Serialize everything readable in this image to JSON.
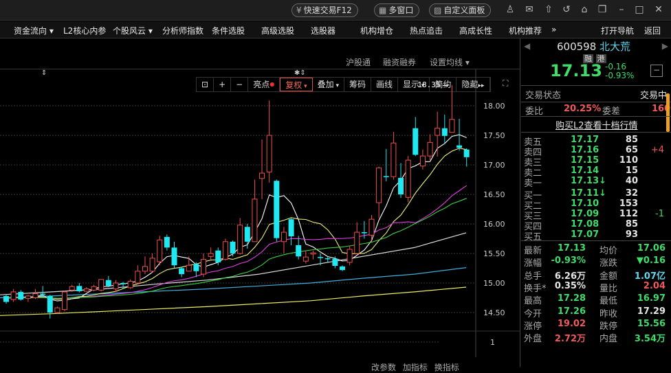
{
  "titlebar": {
    "quick_trade": "快速交易F12",
    "multi_window": "多窗口",
    "custom_panel": "自定义面板"
  },
  "menu": [
    "资金流向",
    "L2核心内参",
    "个股风云",
    "分析师指数",
    "条件选股",
    "高级选股",
    "选股器",
    "机构增仓",
    "热点追击",
    "高成长性",
    "机构推荐",
    "»"
  ],
  "menu_right": [
    "打开导航",
    "返回"
  ],
  "toolbar": [
    "亮点",
    "复权",
    "叠加",
    "筹码",
    "画线",
    "显示",
    "简约",
    "隐藏"
  ],
  "subbar": [
    "沪股通",
    "融资融券",
    "设置均线"
  ],
  "bottom_tabs": [
    "改参数",
    "加指标",
    "换指标"
  ],
  "chart_data": {
    "type": "candlestick",
    "ylim": [
      14.3,
      18.55
    ],
    "yticks": [
      "18.00",
      "17.50",
      "17.00",
      "16.50",
      "16.00",
      "15.50",
      "15.00",
      "14.50"
    ],
    "yvalues": [
      18,
      17.5,
      17,
      16.5,
      16,
      15.5,
      15,
      14.5
    ],
    "high_annotation": "18.35",
    "volume_axis_label": "1",
    "ohlc": [
      [
        14.78,
        14.8,
        14.65,
        14.68
      ],
      [
        14.72,
        14.9,
        14.68,
        14.85
      ],
      [
        14.85,
        14.88,
        14.7,
        14.72
      ],
      [
        14.74,
        14.8,
        14.68,
        14.78
      ],
      [
        14.75,
        14.9,
        14.73,
        14.82
      ],
      [
        14.82,
        14.95,
        14.78,
        14.8
      ],
      [
        14.78,
        14.8,
        14.4,
        14.5
      ],
      [
        14.5,
        14.6,
        14.48,
        14.58
      ],
      [
        14.55,
        14.87,
        14.52,
        14.85
      ],
      [
        14.88,
        14.97,
        14.85,
        14.94
      ],
      [
        14.95,
        15.0,
        14.84,
        14.86
      ],
      [
        14.86,
        14.93,
        14.85,
        14.9
      ],
      [
        14.88,
        14.97,
        14.86,
        14.94
      ],
      [
        14.88,
        15.06,
        14.86,
        15.06
      ],
      [
        15.05,
        15.12,
        14.93,
        14.95
      ],
      [
        14.9,
        15.05,
        14.85,
        15.0
      ],
      [
        15.0,
        15.02,
        14.9,
        14.98
      ],
      [
        14.92,
        15.06,
        14.9,
        15.03
      ],
      [
        15.0,
        15.3,
        14.98,
        15.2
      ],
      [
        15.2,
        15.45,
        15.15,
        15.28
      ],
      [
        15.2,
        15.5,
        15.18,
        15.42
      ],
      [
        15.36,
        15.8,
        15.3,
        15.73
      ],
      [
        15.78,
        15.82,
        15.55,
        15.6
      ],
      [
        15.6,
        15.7,
        15.25,
        15.3
      ],
      [
        15.25,
        15.28,
        15.1,
        15.15
      ],
      [
        15.2,
        15.45,
        15.2,
        15.3
      ],
      [
        15.32,
        15.35,
        15.1,
        15.2
      ],
      [
        15.15,
        15.5,
        15.1,
        15.4
      ],
      [
        15.45,
        15.6,
        15.4,
        15.5
      ],
      [
        15.55,
        15.6,
        15.3,
        15.35
      ],
      [
        15.4,
        15.75,
        15.38,
        15.7
      ],
      [
        15.7,
        15.72,
        15.45,
        15.5
      ],
      [
        15.5,
        16.1,
        15.48,
        15.98
      ],
      [
        15.95,
        16.0,
        15.58,
        15.7
      ],
      [
        15.7,
        16.75,
        15.7,
        16.42
      ],
      [
        16.77,
        17.43,
        16.42,
        16.86
      ],
      [
        16.88,
        18.09,
        16.7,
        17.5
      ],
      [
        16.73,
        16.75,
        15.7,
        15.76
      ],
      [
        15.7,
        15.95,
        15.5,
        15.86
      ],
      [
        16.08,
        16.1,
        15.64,
        15.79
      ],
      [
        15.64,
        15.8,
        15.4,
        15.45
      ],
      [
        15.37,
        15.55,
        15.33,
        15.44
      ],
      [
        15.49,
        15.55,
        15.4,
        15.51
      ],
      [
        15.44,
        15.5,
        15.3,
        15.43
      ],
      [
        15.42,
        15.45,
        15.35,
        15.41
      ],
      [
        15.41,
        15.45,
        15.25,
        15.29
      ],
      [
        15.28,
        15.3,
        15.2,
        15.22
      ],
      [
        15.35,
        15.63,
        15.3,
        15.57
      ],
      [
        15.5,
        16.03,
        15.5,
        15.86
      ],
      [
        15.86,
        16.05,
        15.75,
        15.85
      ],
      [
        15.81,
        16.15,
        15.72,
        16.08
      ],
      [
        16.36,
        16.97,
        16.1,
        16.95
      ],
      [
        16.81,
        17.27,
        16.72,
        16.8
      ],
      [
        16.8,
        17.56,
        16.75,
        17.37
      ],
      [
        16.78,
        17.03,
        16.44,
        16.5
      ],
      [
        16.45,
        17.15,
        16.37,
        17.08
      ],
      [
        17.62,
        17.81,
        17.15,
        17.17
      ],
      [
        16.98,
        17.26,
        16.92,
        17.15
      ],
      [
        17.15,
        17.52,
        17.08,
        17.38
      ],
      [
        17.5,
        17.9,
        17.14,
        17.62
      ],
      [
        17.62,
        17.85,
        17.35,
        17.49
      ],
      [
        17.55,
        18.35,
        17.55,
        17.77
      ],
      [
        17.33,
        17.78,
        17.24,
        17.29
      ],
      [
        17.26,
        17.28,
        16.97,
        17.13
      ]
    ],
    "ma_series": [
      {
        "name": "MA5",
        "period": 5,
        "color": "#ffffff"
      },
      {
        "name": "MA10",
        "period": 10,
        "color": "#f0f080"
      },
      {
        "name": "MA20",
        "period": 20,
        "color": "#e040e0"
      },
      {
        "name": "MA30",
        "period": 30,
        "color": "#40d040"
      }
    ],
    "long_series": [
      {
        "name": "MA60",
        "color": "#dddddd",
        "values": [
          14.8,
          14.85,
          14.9,
          14.98,
          15.05,
          15.15,
          15.3,
          15.45,
          15.6,
          15.85
        ]
      },
      {
        "name": "MA120",
        "color": "#40b0e0",
        "values": [
          14.75,
          14.78,
          14.82,
          14.86,
          14.9,
          14.95,
          15.0,
          15.08,
          15.15,
          15.26
        ]
      },
      {
        "name": "MA250",
        "color": "#f0f060",
        "values": [
          14.45,
          14.48,
          14.52,
          14.56,
          14.6,
          14.65,
          14.7,
          14.78,
          14.85,
          14.93
        ]
      }
    ]
  },
  "quote": {
    "code": "600598",
    "name": "北大荒",
    "tag1": "融",
    "tag2": "港",
    "price": "17.13",
    "change": "-0.16",
    "pct": "-0.93%",
    "status_label": "交易状态",
    "status": "交易中",
    "wb_label": "委比",
    "wb": "20.25%",
    "wc_label": "委差",
    "wc": "160",
    "l2_link": "购买L2查看十档行情",
    "asks": [
      {
        "label": "卖五",
        "price": "17.17",
        "vol": "85",
        "chg": ""
      },
      {
        "label": "卖四",
        "price": "17.16",
        "vol": "65",
        "chg": "+4"
      },
      {
        "label": "卖三",
        "price": "17.15",
        "vol": "110",
        "chg": ""
      },
      {
        "label": "卖二",
        "price": "17.14",
        "vol": "15",
        "chg": ""
      },
      {
        "label": "卖一",
        "price": "17.13↓",
        "vol": "40",
        "chg": ""
      }
    ],
    "bids": [
      {
        "label": "买一",
        "price": "17.11↓",
        "vol": "32",
        "chg": ""
      },
      {
        "label": "买二",
        "price": "17.10",
        "vol": "153",
        "chg": ""
      },
      {
        "label": "买三",
        "price": "17.09",
        "vol": "112",
        "chg": "-1"
      },
      {
        "label": "买四",
        "price": "17.08",
        "vol": "85",
        "chg": ""
      },
      {
        "label": "买五",
        "price": "17.07",
        "vol": "93",
        "chg": ""
      }
    ],
    "stats": [
      {
        "l1": "最新",
        "v1": "17.13",
        "c1": "g",
        "l2": "均价",
        "v2": "17.06",
        "c2": "g"
      },
      {
        "l1": "涨幅",
        "v1": "-0.93%",
        "c1": "g",
        "l2": "涨跌",
        "v2": "▼0.16",
        "c2": "g"
      },
      {
        "l1": "总手",
        "v1": "6.26万",
        "c1": "w",
        "l2": "金额",
        "v2": "1.07亿",
        "c2": "c"
      },
      {
        "l1": "换手*",
        "v1": "0.35%",
        "c1": "w",
        "l2": "量比",
        "v2": "2.04",
        "c2": "r"
      },
      {
        "l1": "最高",
        "v1": "17.28",
        "c1": "g",
        "l2": "最低",
        "v2": "16.97",
        "c2": "g"
      },
      {
        "l1": "今开",
        "v1": "17.26",
        "c1": "g",
        "l2": "昨收",
        "v2": "17.29",
        "c2": "w"
      },
      {
        "l1": "涨停",
        "v1": "19.02",
        "c1": "r",
        "l2": "跌停",
        "v2": "15.56",
        "c2": "g"
      },
      {
        "l1": "外盘",
        "v1": "2.72万",
        "c1": "r",
        "l2": "内盘",
        "v2": "3.54万",
        "c2": "g"
      }
    ]
  }
}
